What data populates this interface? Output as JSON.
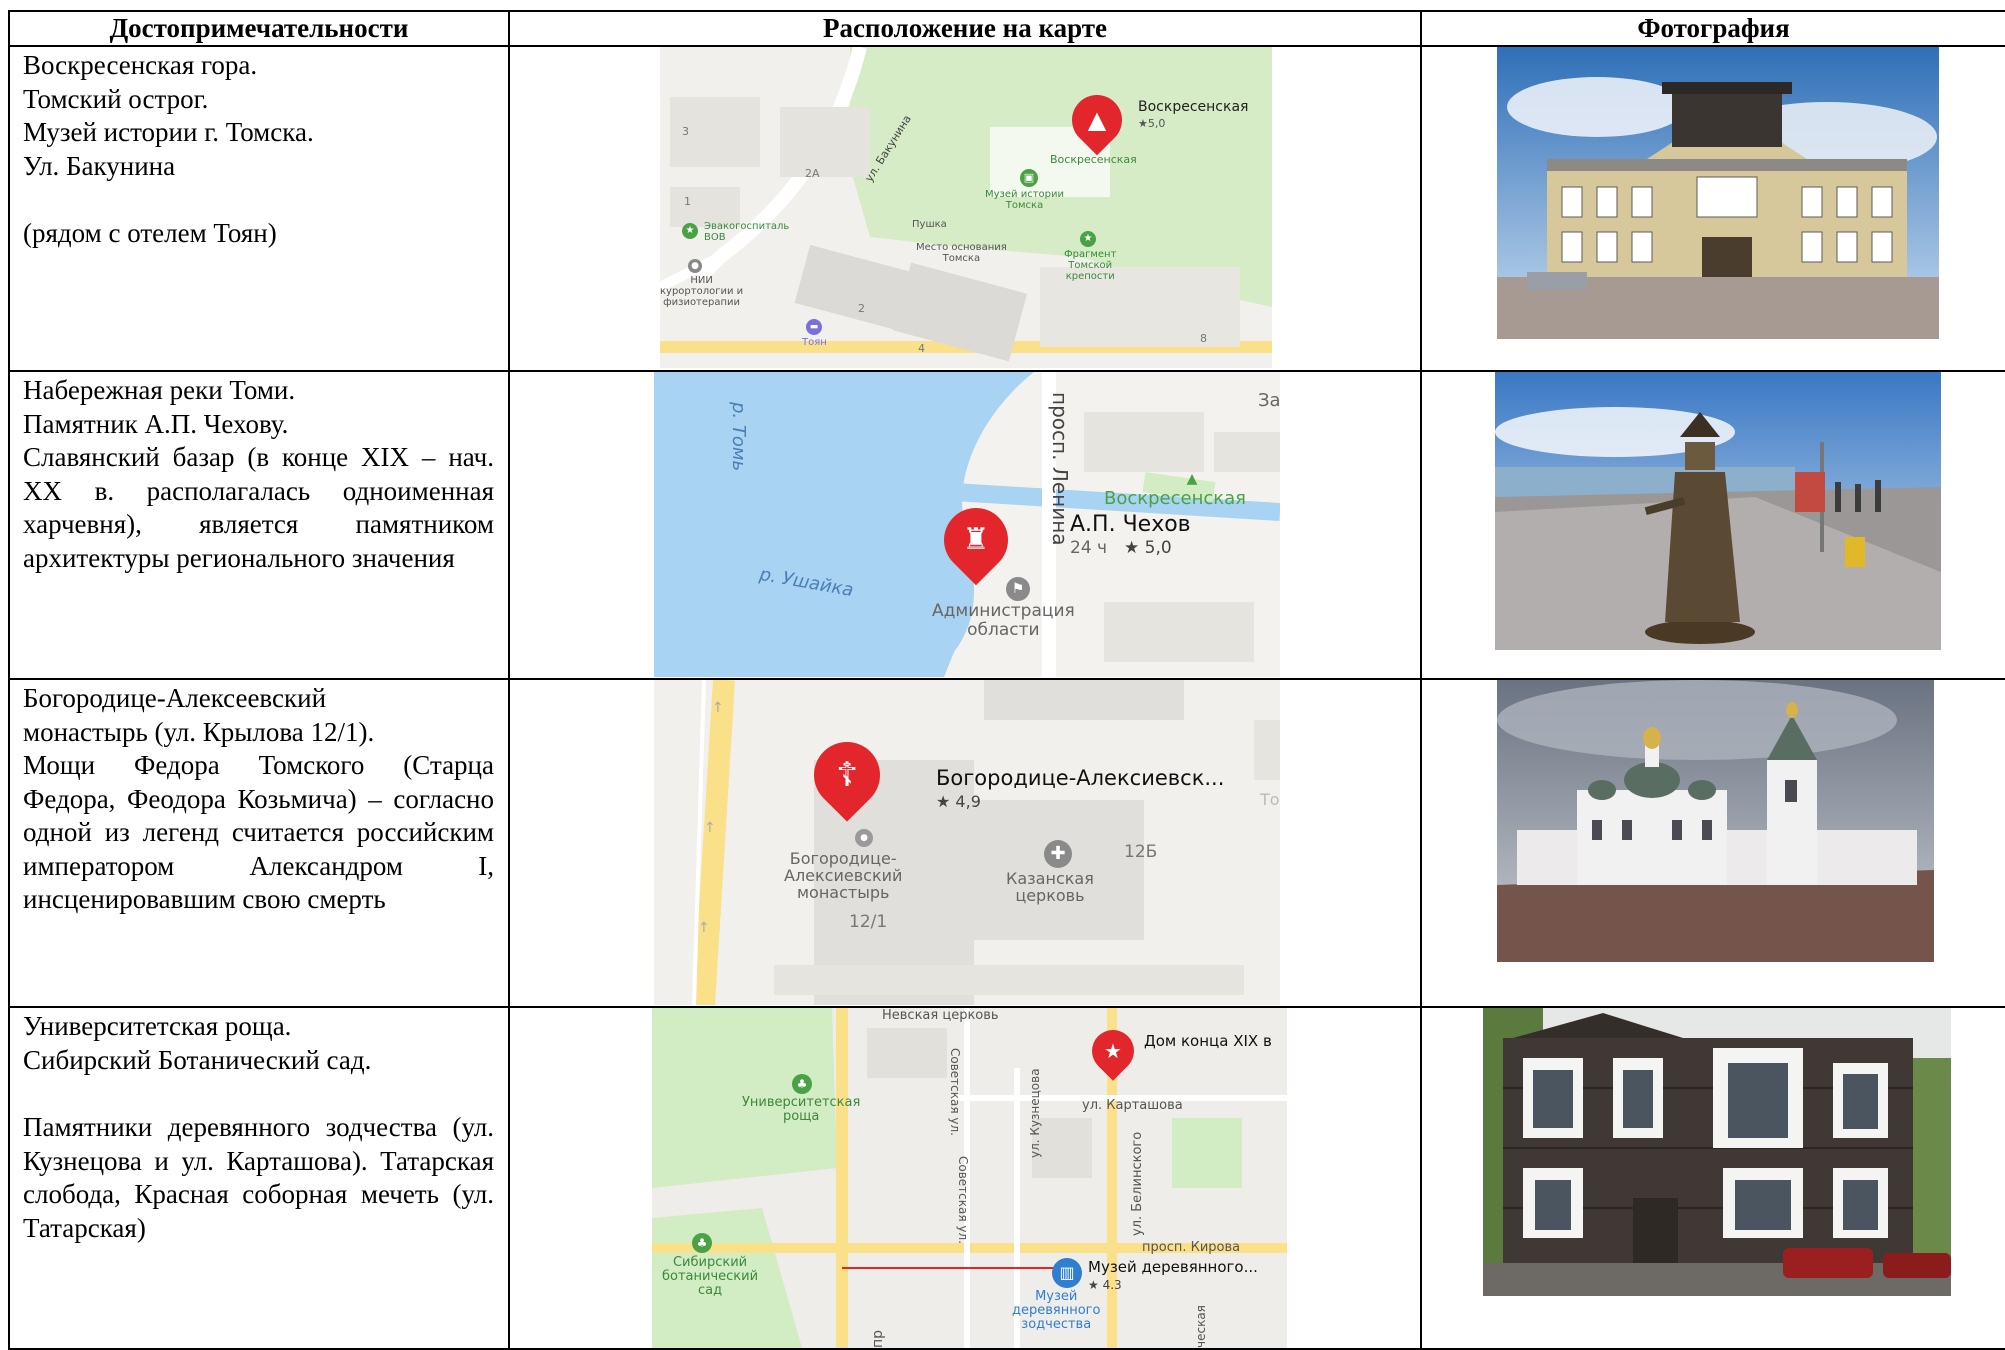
{
  "headers": {
    "col1": "Достопримечательности",
    "col2": "Расположение на карте",
    "col3": "Фотография"
  },
  "rows": [
    {
      "lines": [
        "Воскресенская гора.",
        "Томский острог.",
        "Музей истории г. Томска.",
        "Ул. Бакунина",
        "(рядом с отелем Тоян)"
      ],
      "map": {
        "street": "ул. Бакунина",
        "place_name": "Воскресенская",
        "place_rating": "★5,0",
        "sub": "Воскресенская",
        "museum": "Музей истории\nТомска",
        "pushka": "Пушка",
        "mesto": "Место основания\nТомска",
        "fragment": "Фрагмент\nТомской\nкрепости",
        "hospital": "Эвакогоспиталь\nВОВ",
        "nii": "НИИ\nкурортологии и\nфизиотерапии",
        "hotel": "Тоян",
        "n3": "3",
        "n2a": "2А",
        "n1": "1",
        "n2": "2",
        "n4": "4",
        "n8": "8"
      }
    },
    {
      "lines": [
        "Набережная реки Томи.",
        "Памятник А.П. Чехову."
      ],
      "justified": "Славянский базар (в конце XIX – нач. XX в. располагалась одноименная харчевня), является памятником архитектуры регионального значения",
      "map": {
        "river": "р. Томь",
        "river2": "р. Ушайка",
        "avenue": "просп. Ленина",
        "green": "Воскресенская",
        "name": "А.П. Чехов",
        "hours": "24 ч",
        "rating": "★ 5,0",
        "admin": "Администрация\nобласти",
        "corner": "За"
      }
    },
    {
      "lines": [
        "Богородице-Алексеевский",
        "монастырь (ул. Крылова 12/1)."
      ],
      "justified": "Мощи Федора Томского (Старца Федора, Феодора Козьмича) – согласно одной из легенд считается российским императором Александром I, инсценировавшим свою смерть",
      "map": {
        "name": "Богородице-Алексиевск...",
        "rating": "★ 4,9",
        "mon": "Богородице-\nАлексиевский\nмонастырь",
        "num": "12/1",
        "church": "Казанская\nцерковь",
        "num2": "12Б",
        "cut": "То"
      }
    },
    {
      "lines": [
        "Университетская роща.",
        "Сибирский Ботанический сад."
      ],
      "justified": "Памятники деревянного зодчества (ул. Кузнецова и ул. Карташова). Татарская слобода, Красная соборная мечеть (ул. Татарская)",
      "map": {
        "top": "Невская церковь",
        "grove": "Университетская\nроща",
        "sov1": "Советская ул.",
        "kuz": "ул. Кузнецова",
        "kart": "ул. Карташова",
        "house": "Дом конца XIX в",
        "bel": "ул. Белинского",
        "sov2": "Советская ул.",
        "kirova": "просп. Кирова",
        "bot": "Сибирский\nботанический\nсад",
        "museum": "Музей деревянного...",
        "mrating": "★ 4.3",
        "mus2": "Музей\nдеревянного\nзодчества",
        "tat": "ческая",
        "pr": "пр"
      }
    }
  ],
  "colors": {
    "pin": "#e3262c",
    "green": "#4aa146",
    "water": "#a9d3f3",
    "park": "#d2ecc3",
    "poi_blue": "#2f7ecf"
  }
}
